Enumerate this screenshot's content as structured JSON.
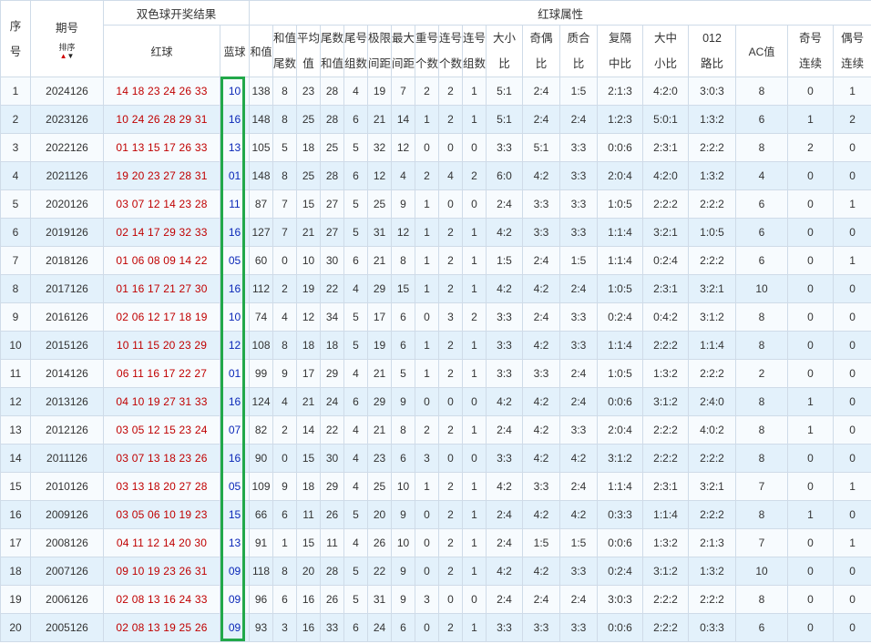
{
  "header": {
    "seq_lines": [
      "序",
      "号"
    ],
    "issue_label": "期号",
    "sort_label": "排序",
    "group_draw": "双色球开奖结果",
    "group_attr": "红球属性",
    "red_label": "红球",
    "blue_label": "蓝球",
    "attrs": [
      [
        "和值"
      ],
      [
        "和值",
        "尾数"
      ],
      [
        "平均",
        "值"
      ],
      [
        "尾数",
        "和值"
      ],
      [
        "尾号",
        "组数"
      ],
      [
        "极限",
        "间距"
      ],
      [
        "最大",
        "间距"
      ],
      [
        "重号",
        "个数"
      ],
      [
        "连号",
        "个数"
      ],
      [
        "连号",
        "组数"
      ],
      [
        "大小",
        "比"
      ],
      [
        "奇偶",
        "比"
      ],
      [
        "质合",
        "比"
      ],
      [
        "复隔",
        "中比"
      ],
      [
        "大中",
        "小比"
      ],
      [
        "012",
        "路比"
      ],
      [
        "AC值"
      ],
      [
        "奇号",
        "连续"
      ],
      [
        "偶号",
        "连续"
      ]
    ]
  },
  "rows": [
    {
      "seq": "1",
      "issue": "2024126",
      "red": "14 18 23 24 26 33",
      "blue": "10",
      "sum": "138",
      "sumtail": "8",
      "avg": "23",
      "tailsum": "28",
      "tailgroups": "4",
      "range": "19",
      "maxgap": "7",
      "repeat": "2",
      "consec": "2",
      "consecgrp": "1",
      "bigsmall": "5:1",
      "oddeven": "2:4",
      "primecomp": "1:5",
      "fgz": "2:1:3",
      "dzx": "4:2:0",
      "road": "3:0:3",
      "ac": "8",
      "oddrun": "0",
      "evenrun": "1"
    },
    {
      "seq": "2",
      "issue": "2023126",
      "red": "10 24 26 28 29 31",
      "blue": "16",
      "sum": "148",
      "sumtail": "8",
      "avg": "25",
      "tailsum": "28",
      "tailgroups": "6",
      "range": "21",
      "maxgap": "14",
      "repeat": "1",
      "consec": "2",
      "consecgrp": "1",
      "bigsmall": "5:1",
      "oddeven": "2:4",
      "primecomp": "2:4",
      "fgz": "1:2:3",
      "dzx": "5:0:1",
      "road": "1:3:2",
      "ac": "6",
      "oddrun": "1",
      "evenrun": "2"
    },
    {
      "seq": "3",
      "issue": "2022126",
      "red": "01 13 15 17 26 33",
      "blue": "13",
      "sum": "105",
      "sumtail": "5",
      "avg": "18",
      "tailsum": "25",
      "tailgroups": "5",
      "range": "32",
      "maxgap": "12",
      "repeat": "0",
      "consec": "0",
      "consecgrp": "0",
      "bigsmall": "3:3",
      "oddeven": "5:1",
      "primecomp": "3:3",
      "fgz": "0:0:6",
      "dzx": "2:3:1",
      "road": "2:2:2",
      "ac": "8",
      "oddrun": "2",
      "evenrun": "0"
    },
    {
      "seq": "4",
      "issue": "2021126",
      "red": "19 20 23 27 28 31",
      "blue": "01",
      "sum": "148",
      "sumtail": "8",
      "avg": "25",
      "tailsum": "28",
      "tailgroups": "6",
      "range": "12",
      "maxgap": "4",
      "repeat": "2",
      "consec": "4",
      "consecgrp": "2",
      "bigsmall": "6:0",
      "oddeven": "4:2",
      "primecomp": "3:3",
      "fgz": "2:0:4",
      "dzx": "4:2:0",
      "road": "1:3:2",
      "ac": "4",
      "oddrun": "0",
      "evenrun": "0"
    },
    {
      "seq": "5",
      "issue": "2020126",
      "red": "03 07 12 14 23 28",
      "blue": "11",
      "sum": "87",
      "sumtail": "7",
      "avg": "15",
      "tailsum": "27",
      "tailgroups": "5",
      "range": "25",
      "maxgap": "9",
      "repeat": "1",
      "consec": "0",
      "consecgrp": "0",
      "bigsmall": "2:4",
      "oddeven": "3:3",
      "primecomp": "3:3",
      "fgz": "1:0:5",
      "dzx": "2:2:2",
      "road": "2:2:2",
      "ac": "6",
      "oddrun": "0",
      "evenrun": "1"
    },
    {
      "seq": "6",
      "issue": "2019126",
      "red": "02 14 17 29 32 33",
      "blue": "16",
      "sum": "127",
      "sumtail": "7",
      "avg": "21",
      "tailsum": "27",
      "tailgroups": "5",
      "range": "31",
      "maxgap": "12",
      "repeat": "1",
      "consec": "2",
      "consecgrp": "1",
      "bigsmall": "4:2",
      "oddeven": "3:3",
      "primecomp": "3:3",
      "fgz": "1:1:4",
      "dzx": "3:2:1",
      "road": "1:0:5",
      "ac": "6",
      "oddrun": "0",
      "evenrun": "0"
    },
    {
      "seq": "7",
      "issue": "2018126",
      "red": "01 06 08 09 14 22",
      "blue": "05",
      "sum": "60",
      "sumtail": "0",
      "avg": "10",
      "tailsum": "30",
      "tailgroups": "6",
      "range": "21",
      "maxgap": "8",
      "repeat": "1",
      "consec": "2",
      "consecgrp": "1",
      "bigsmall": "1:5",
      "oddeven": "2:4",
      "primecomp": "1:5",
      "fgz": "1:1:4",
      "dzx": "0:2:4",
      "road": "2:2:2",
      "ac": "6",
      "oddrun": "0",
      "evenrun": "1"
    },
    {
      "seq": "8",
      "issue": "2017126",
      "red": "01 16 17 21 27 30",
      "blue": "16",
      "sum": "112",
      "sumtail": "2",
      "avg": "19",
      "tailsum": "22",
      "tailgroups": "4",
      "range": "29",
      "maxgap": "15",
      "repeat": "1",
      "consec": "2",
      "consecgrp": "1",
      "bigsmall": "4:2",
      "oddeven": "4:2",
      "primecomp": "2:4",
      "fgz": "1:0:5",
      "dzx": "2:3:1",
      "road": "3:2:1",
      "ac": "10",
      "oddrun": "0",
      "evenrun": "0"
    },
    {
      "seq": "9",
      "issue": "2016126",
      "red": "02 06 12 17 18 19",
      "blue": "10",
      "sum": "74",
      "sumtail": "4",
      "avg": "12",
      "tailsum": "34",
      "tailgroups": "5",
      "range": "17",
      "maxgap": "6",
      "repeat": "0",
      "consec": "3",
      "consecgrp": "2",
      "bigsmall": "3:3",
      "oddeven": "2:4",
      "primecomp": "3:3",
      "fgz": "0:2:4",
      "dzx": "0:4:2",
      "road": "3:1:2",
      "ac": "8",
      "oddrun": "0",
      "evenrun": "0"
    },
    {
      "seq": "10",
      "issue": "2015126",
      "red": "10 11 15 20 23 29",
      "blue": "12",
      "sum": "108",
      "sumtail": "8",
      "avg": "18",
      "tailsum": "18",
      "tailgroups": "5",
      "range": "19",
      "maxgap": "6",
      "repeat": "1",
      "consec": "2",
      "consecgrp": "1",
      "bigsmall": "3:3",
      "oddeven": "4:2",
      "primecomp": "3:3",
      "fgz": "1:1:4",
      "dzx": "2:2:2",
      "road": "1:1:4",
      "ac": "8",
      "oddrun": "0",
      "evenrun": "0"
    },
    {
      "seq": "11",
      "issue": "2014126",
      "red": "06 11 16 17 22 27",
      "blue": "01",
      "sum": "99",
      "sumtail": "9",
      "avg": "17",
      "tailsum": "29",
      "tailgroups": "4",
      "range": "21",
      "maxgap": "5",
      "repeat": "1",
      "consec": "2",
      "consecgrp": "1",
      "bigsmall": "3:3",
      "oddeven": "3:3",
      "primecomp": "2:4",
      "fgz": "1:0:5",
      "dzx": "1:3:2",
      "road": "2:2:2",
      "ac": "2",
      "oddrun": "0",
      "evenrun": "0"
    },
    {
      "seq": "12",
      "issue": "2013126",
      "red": "04 10 19 27 31 33",
      "blue": "16",
      "sum": "124",
      "sumtail": "4",
      "avg": "21",
      "tailsum": "24",
      "tailgroups": "6",
      "range": "29",
      "maxgap": "9",
      "repeat": "0",
      "consec": "0",
      "consecgrp": "0",
      "bigsmall": "4:2",
      "oddeven": "4:2",
      "primecomp": "2:4",
      "fgz": "0:0:6",
      "dzx": "3:1:2",
      "road": "2:4:0",
      "ac": "8",
      "oddrun": "1",
      "evenrun": "0"
    },
    {
      "seq": "13",
      "issue": "2012126",
      "red": "03 05 12 15 23 24",
      "blue": "07",
      "sum": "82",
      "sumtail": "2",
      "avg": "14",
      "tailsum": "22",
      "tailgroups": "4",
      "range": "21",
      "maxgap": "8",
      "repeat": "2",
      "consec": "2",
      "consecgrp": "1",
      "bigsmall": "2:4",
      "oddeven": "4:2",
      "primecomp": "3:3",
      "fgz": "2:0:4",
      "dzx": "2:2:2",
      "road": "4:0:2",
      "ac": "8",
      "oddrun": "1",
      "evenrun": "0"
    },
    {
      "seq": "14",
      "issue": "2011126",
      "red": "03 07 13 18 23 26",
      "blue": "16",
      "sum": "90",
      "sumtail": "0",
      "avg": "15",
      "tailsum": "30",
      "tailgroups": "4",
      "range": "23",
      "maxgap": "6",
      "repeat": "3",
      "consec": "0",
      "consecgrp": "0",
      "bigsmall": "3:3",
      "oddeven": "4:2",
      "primecomp": "4:2",
      "fgz": "3:1:2",
      "dzx": "2:2:2",
      "road": "2:2:2",
      "ac": "8",
      "oddrun": "0",
      "evenrun": "0"
    },
    {
      "seq": "15",
      "issue": "2010126",
      "red": "03 13 18 20 27 28",
      "blue": "05",
      "sum": "109",
      "sumtail": "9",
      "avg": "18",
      "tailsum": "29",
      "tailgroups": "4",
      "range": "25",
      "maxgap": "10",
      "repeat": "1",
      "consec": "2",
      "consecgrp": "1",
      "bigsmall": "4:2",
      "oddeven": "3:3",
      "primecomp": "2:4",
      "fgz": "1:1:4",
      "dzx": "2:3:1",
      "road": "3:2:1",
      "ac": "7",
      "oddrun": "0",
      "evenrun": "1"
    },
    {
      "seq": "16",
      "issue": "2009126",
      "red": "03 05 06 10 19 23",
      "blue": "15",
      "sum": "66",
      "sumtail": "6",
      "avg": "11",
      "tailsum": "26",
      "tailgroups": "5",
      "range": "20",
      "maxgap": "9",
      "repeat": "0",
      "consec": "2",
      "consecgrp": "1",
      "bigsmall": "2:4",
      "oddeven": "4:2",
      "primecomp": "4:2",
      "fgz": "0:3:3",
      "dzx": "1:1:4",
      "road": "2:2:2",
      "ac": "8",
      "oddrun": "1",
      "evenrun": "0"
    },
    {
      "seq": "17",
      "issue": "2008126",
      "red": "04 11 12 14 20 30",
      "blue": "13",
      "sum": "91",
      "sumtail": "1",
      "avg": "15",
      "tailsum": "11",
      "tailgroups": "4",
      "range": "26",
      "maxgap": "10",
      "repeat": "0",
      "consec": "2",
      "consecgrp": "1",
      "bigsmall": "2:4",
      "oddeven": "1:5",
      "primecomp": "1:5",
      "fgz": "0:0:6",
      "dzx": "1:3:2",
      "road": "2:1:3",
      "ac": "7",
      "oddrun": "0",
      "evenrun": "1"
    },
    {
      "seq": "18",
      "issue": "2007126",
      "red": "09 10 19 23 26 31",
      "blue": "09",
      "sum": "118",
      "sumtail": "8",
      "avg": "20",
      "tailsum": "28",
      "tailgroups": "5",
      "range": "22",
      "maxgap": "9",
      "repeat": "0",
      "consec": "2",
      "consecgrp": "1",
      "bigsmall": "4:2",
      "oddeven": "4:2",
      "primecomp": "3:3",
      "fgz": "0:2:4",
      "dzx": "3:1:2",
      "road": "1:3:2",
      "ac": "10",
      "oddrun": "0",
      "evenrun": "0"
    },
    {
      "seq": "19",
      "issue": "2006126",
      "red": "02 08 13 16 24 33",
      "blue": "09",
      "sum": "96",
      "sumtail": "6",
      "avg": "16",
      "tailsum": "26",
      "tailgroups": "5",
      "range": "31",
      "maxgap": "9",
      "repeat": "3",
      "consec": "0",
      "consecgrp": "0",
      "bigsmall": "2:4",
      "oddeven": "2:4",
      "primecomp": "2:4",
      "fgz": "3:0:3",
      "dzx": "2:2:2",
      "road": "2:2:2",
      "ac": "8",
      "oddrun": "0",
      "evenrun": "0"
    },
    {
      "seq": "20",
      "issue": "2005126",
      "red": "02 08 13 19 25 26",
      "blue": "09",
      "sum": "93",
      "sumtail": "3",
      "avg": "16",
      "tailsum": "33",
      "tailgroups": "6",
      "range": "24",
      "maxgap": "6",
      "repeat": "0",
      "consec": "2",
      "consecgrp": "1",
      "bigsmall": "3:3",
      "oddeven": "3:3",
      "primecomp": "3:3",
      "fgz": "0:0:6",
      "dzx": "2:2:2",
      "road": "0:3:3",
      "ac": "6",
      "oddrun": "0",
      "evenrun": "0"
    }
  ]
}
